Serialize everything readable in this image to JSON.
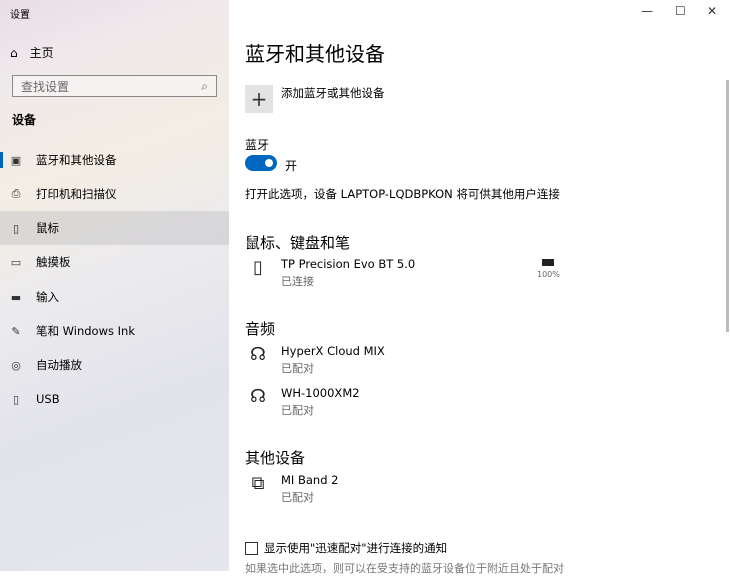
{
  "window": {
    "title": "设置",
    "minimize": "—",
    "maximize": "☐",
    "close": "✕"
  },
  "sidebar": {
    "home": "主页",
    "search_placeholder": "查找设置",
    "section": "设备",
    "items": [
      {
        "label": "蓝牙和其他设备",
        "icon": "▣"
      },
      {
        "label": "打印机和扫描仪",
        "icon": "⎙"
      },
      {
        "label": "鼠标",
        "icon": "▯"
      },
      {
        "label": "触摸板",
        "icon": "▭"
      },
      {
        "label": "输入",
        "icon": "▬"
      },
      {
        "label": "笔和 Windows Ink",
        "icon": "✎"
      },
      {
        "label": "自动播放",
        "icon": "◎"
      },
      {
        "label": "USB",
        "icon": "▯"
      }
    ]
  },
  "main": {
    "title": "蓝牙和其他设备",
    "add_label": "添加蓝牙或其他设备",
    "bt_label": "蓝牙",
    "bt_state": "开",
    "discoverable": "打开此选项，设备 LAPTOP-LQDBPKON 将可供其他用户连接",
    "groups": [
      {
        "title": "鼠标、键盘和笔",
        "devices": [
          {
            "name": "TP Precision Evo BT 5.0",
            "status": "已连接",
            "battery": "100%"
          }
        ]
      },
      {
        "title": "音频",
        "devices": [
          {
            "name": "HyperX Cloud MIX",
            "status": "已配对"
          },
          {
            "name": "WH-1000XM2",
            "status": "已配对"
          }
        ]
      },
      {
        "title": "其他设备",
        "devices": [
          {
            "name": "MI Band 2",
            "status": "已配对"
          }
        ]
      }
    ],
    "swift_pair": "显示使用\"迅速配对\"进行连接的通知",
    "swift_note": "如果选中此选项，则可以在受支持的蓝牙设备位于附近且处于配对"
  }
}
